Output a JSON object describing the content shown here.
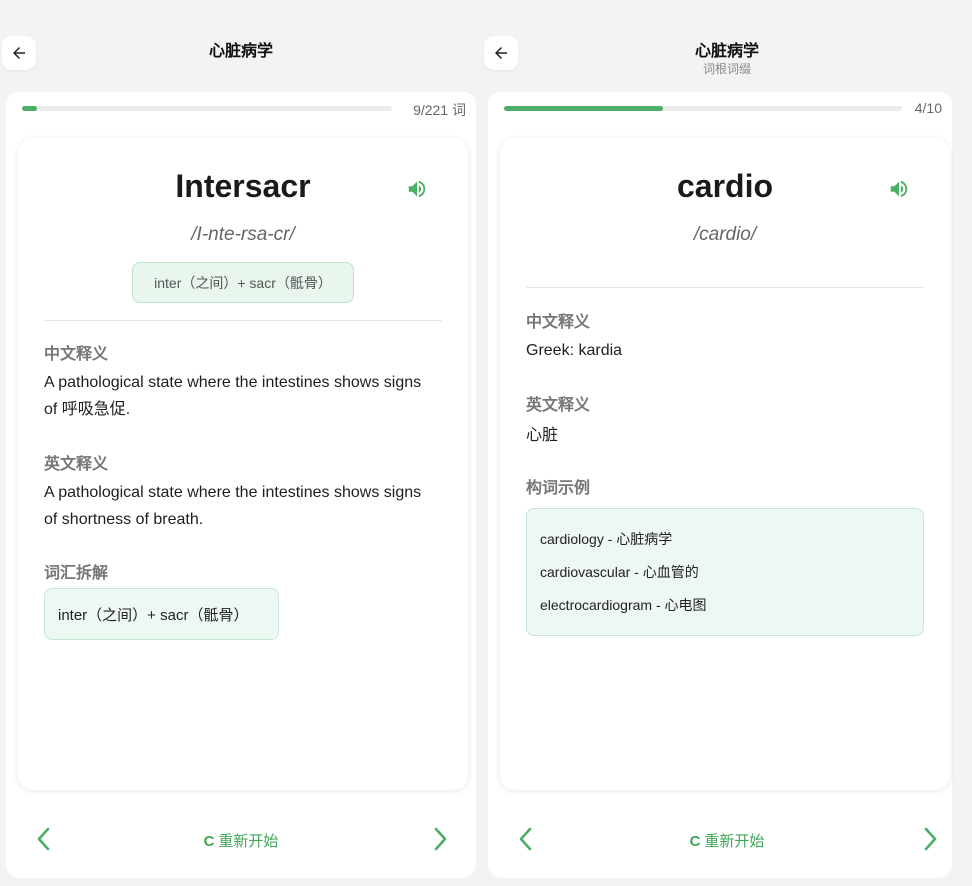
{
  "left": {
    "title": "心脏病学",
    "progress": {
      "text": "9/221 词",
      "fraction": 0.041
    },
    "word": "Intersacr",
    "phonetic": "/I-nte-rsa-cr/",
    "breakdown_chip": "inter（之间）+ sacr（骶骨）",
    "sections": {
      "cn_label": "中文释义",
      "cn_text": "A pathological state where the intestines shows signs of 呼吸急促.",
      "en_label": "英文释义",
      "en_text": "A pathological state where the intestines shows signs of shortness of breath.",
      "decomp_label": "词汇拆解",
      "decomp_text": "inter（之间）+ sacr（骶骨）"
    },
    "nav": {
      "restart": "重新开始",
      "restart_glyph": "C"
    }
  },
  "right": {
    "title": "心脏病学",
    "subtitle": "词根词缀",
    "progress": {
      "text": "4/10",
      "fraction": 0.4
    },
    "word": "cardio",
    "phonetic": "/cardio/",
    "sections": {
      "cn_label": "中文释义",
      "cn_text": "Greek: kardia",
      "en_label": "英文释义",
      "en_text": "心脏",
      "examples_label": "构词示例",
      "examples": [
        "cardiology - 心脏病学",
        "cardiovascular - 心血管的",
        "electrocardiogram - 心电图"
      ]
    },
    "nav": {
      "restart": "重新开始",
      "restart_glyph": "C"
    }
  },
  "colors": {
    "accent": "#4caf65",
    "chip_bg": "#e9f6ee",
    "chip_border": "#bde3c9"
  },
  "icons": [
    "back-arrow-icon",
    "speaker-icon",
    "chevron-left-icon",
    "chevron-right-icon",
    "refresh-icon"
  ]
}
